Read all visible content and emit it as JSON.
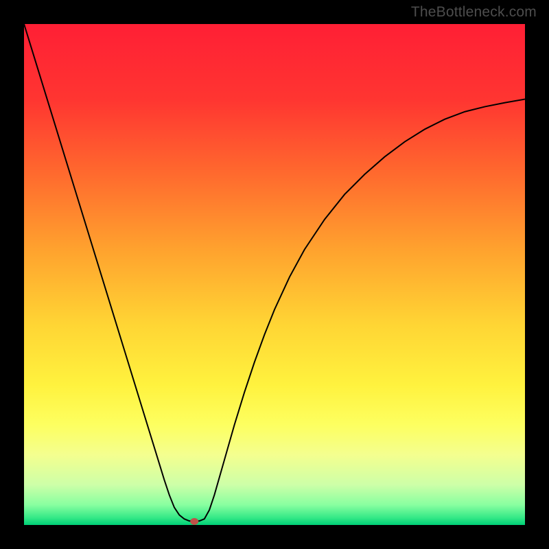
{
  "watermark": "TheBottleneck.com",
  "chart_data": {
    "type": "line",
    "title": "",
    "xlabel": "",
    "ylabel": "",
    "xlim": [
      0,
      100
    ],
    "ylim": [
      0,
      100
    ],
    "background_gradient": {
      "direction": "vertical",
      "stops": [
        {
          "offset": 0.0,
          "color": "#ff1f35"
        },
        {
          "offset": 0.15,
          "color": "#ff3531"
        },
        {
          "offset": 0.3,
          "color": "#ff6a2e"
        },
        {
          "offset": 0.45,
          "color": "#ffa22e"
        },
        {
          "offset": 0.6,
          "color": "#ffd534"
        },
        {
          "offset": 0.72,
          "color": "#fff23e"
        },
        {
          "offset": 0.8,
          "color": "#fdff60"
        },
        {
          "offset": 0.86,
          "color": "#f4ff8f"
        },
        {
          "offset": 0.92,
          "color": "#cdffa8"
        },
        {
          "offset": 0.96,
          "color": "#88ffa0"
        },
        {
          "offset": 0.985,
          "color": "#36e987"
        },
        {
          "offset": 1.0,
          "color": "#00d077"
        }
      ]
    },
    "series": [
      {
        "name": "bottleneck-curve",
        "color": "#000000",
        "stroke_width": 2,
        "x": [
          0,
          2,
          4,
          6,
          8,
          10,
          12,
          14,
          16,
          18,
          20,
          22,
          24,
          26,
          28,
          29,
          30,
          31,
          32,
          33,
          34,
          35,
          36,
          37,
          38,
          40,
          42,
          44,
          46,
          48,
          50,
          53,
          56,
          60,
          64,
          68,
          72,
          76,
          80,
          84,
          88,
          92,
          96,
          100
        ],
        "y": [
          100,
          93.5,
          87,
          80.5,
          74,
          67.5,
          61,
          54.5,
          48,
          41.5,
          35,
          28.5,
          22,
          15.5,
          9,
          6,
          3.5,
          2,
          1.2,
          0.8,
          0.7,
          0.8,
          1.2,
          3,
          6,
          13,
          20,
          26.5,
          32.5,
          38,
          43,
          49.5,
          55,
          61,
          66,
          70,
          73.5,
          76.5,
          79,
          81,
          82.5,
          83.5,
          84.3,
          85
        ]
      }
    ],
    "marker": {
      "name": "optimal-point",
      "x": 34,
      "y": 0.7,
      "color": "#c05048",
      "rx": 6,
      "ry": 5
    }
  }
}
